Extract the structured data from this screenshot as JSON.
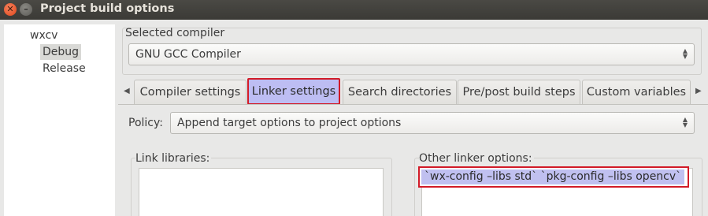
{
  "window": {
    "title": "Project build options"
  },
  "tree": {
    "root": "wxcv",
    "selected": "Debug",
    "other": "Release"
  },
  "compiler": {
    "label": "Selected compiler",
    "value": "GNU GCC Compiler"
  },
  "tabs": [
    {
      "label": "Compiler settings"
    },
    {
      "label": "Linker settings"
    },
    {
      "label": "Search directories"
    },
    {
      "label": "Pre/post build steps"
    },
    {
      "label": "Custom variables"
    }
  ],
  "policy": {
    "label": "Policy:",
    "value": "Append target options to project options"
  },
  "link_libraries": {
    "label": "Link libraries:"
  },
  "other_linker": {
    "label": "Other linker options:",
    "value": "`wx-config –libs std` `pkg-config –libs opencv`"
  },
  "icons": {
    "close": "close-icon",
    "minimize": "minimize-icon",
    "tab_left": "tab-scroll-left-icon",
    "tab_right": "tab-scroll-right-icon"
  },
  "colors": {
    "highlight_border": "#d21b28",
    "selection": "#bdbdf3",
    "titlebar": "#3b3a36"
  }
}
